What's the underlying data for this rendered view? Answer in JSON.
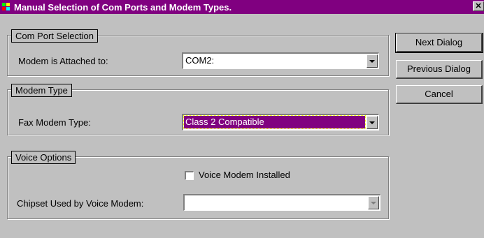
{
  "window": {
    "title": "Manual Selection of Com Ports and Modem Types.",
    "close_glyph": "✕",
    "title_color": "#800080"
  },
  "com_port": {
    "legend": "Com Port Selection",
    "label": "Modem is Attached to:",
    "value": "COM2:"
  },
  "modem_type": {
    "legend": "Modem Type",
    "label": "Fax Modem Type:",
    "value": "Class 2 Compatible",
    "selected_bg": "#800080"
  },
  "voice": {
    "legend": "Voice Options",
    "checkbox_label": "Voice Modem Installed",
    "checked": false,
    "chipset_label": "Chipset Used by Voice Modem:",
    "chipset_value": ""
  },
  "buttons": {
    "next": "Next Dialog",
    "previous": "Previous Dialog",
    "cancel": "Cancel"
  }
}
